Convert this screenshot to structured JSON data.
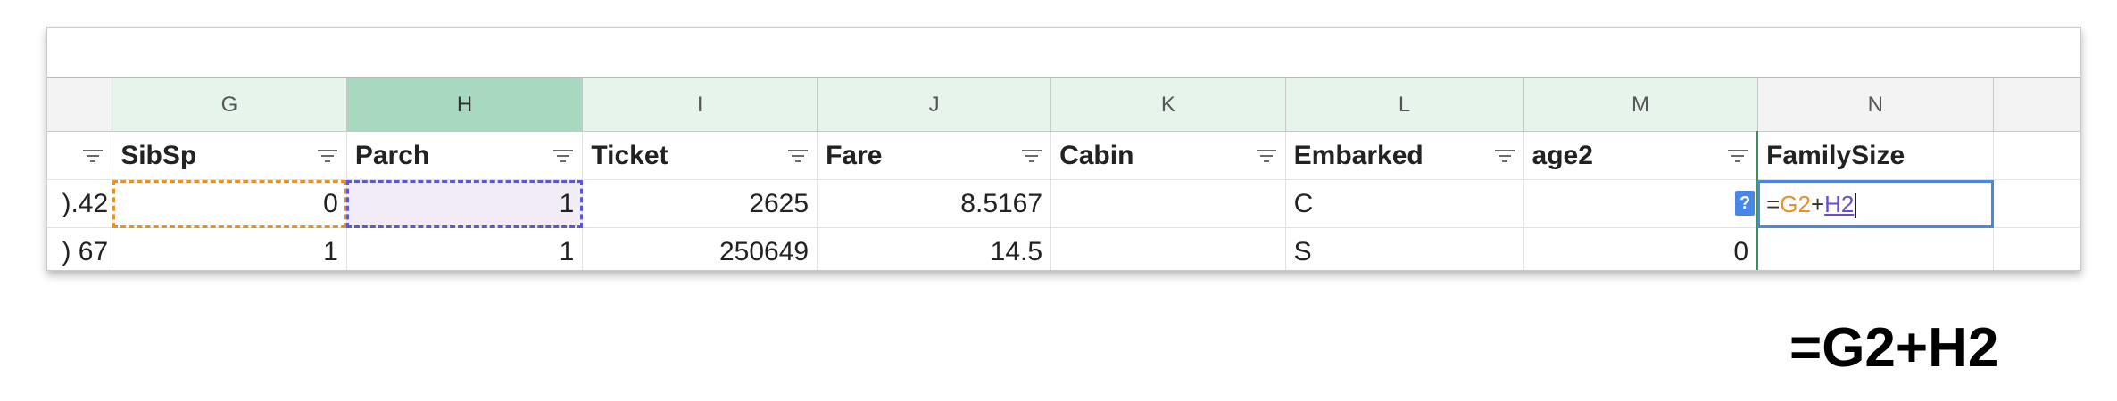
{
  "columns": [
    {
      "letter": ""
    },
    {
      "letter": "G"
    },
    {
      "letter": "H"
    },
    {
      "letter": "I"
    },
    {
      "letter": "J"
    },
    {
      "letter": "K"
    },
    {
      "letter": "L"
    },
    {
      "letter": "M"
    },
    {
      "letter": "N"
    },
    {
      "letter": ""
    }
  ],
  "headers": [
    "",
    "SibSp",
    "Parch",
    "Ticket",
    "Fare",
    "Cabin",
    "Embarked",
    "age2",
    "FamilySize"
  ],
  "rows": [
    {
      "partial": ").42",
      "sibsp": "0",
      "parch": "1",
      "ticket": "2625",
      "fare": "8.5167",
      "cabin": "",
      "embarked": "C",
      "age2": "",
      "familysize": ""
    },
    {
      "partial": ") 67",
      "sibsp": "1",
      "parch": "1",
      "ticket": "250649",
      "fare": "14.5",
      "cabin": "",
      "embarked": "S",
      "age2": "0",
      "familysize": ""
    }
  ],
  "formula_editor": {
    "help": "?",
    "eq": "=",
    "ref1": "G2",
    "op": "+",
    "ref2": "H2"
  },
  "caption": "=G2+H2",
  "colors": {
    "selected_column": "#a8d9c0",
    "ref_g2": "#e8902a",
    "ref_h2": "#5b57d6",
    "active_border": "#4a86e8"
  }
}
